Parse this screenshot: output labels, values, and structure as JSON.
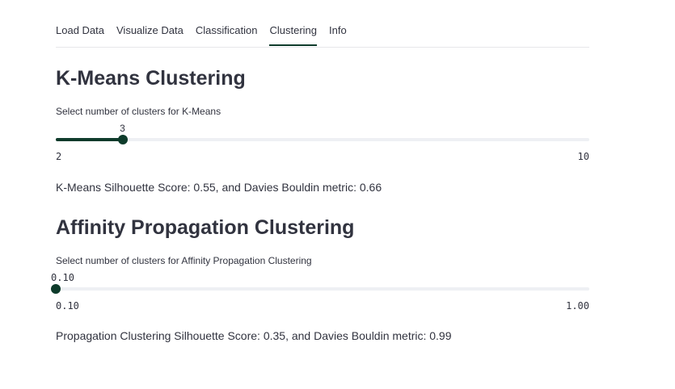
{
  "tabs": [
    {
      "label": "Load Data",
      "active": false
    },
    {
      "label": "Visualize Data",
      "active": false
    },
    {
      "label": "Classification",
      "active": false
    },
    {
      "label": "Clustering",
      "active": true
    },
    {
      "label": "Info",
      "active": false
    }
  ],
  "kmeans": {
    "title": "K-Means Clustering",
    "slider_label": "Select number of clusters for K-Means",
    "slider": {
      "min_label": "2",
      "max_label": "10",
      "value_label": "3",
      "min": 2,
      "max": 10,
      "value": 3
    },
    "result": "K-Means Silhouette Score: 0.55, and Davies Bouldin metric: 0.66"
  },
  "affinity": {
    "title": "Affinity Propagation Clustering",
    "slider_label": "Select number of clusters for Affinity Propagation Clustering",
    "slider": {
      "min_label": "0.10",
      "max_label": "1.00",
      "value_label": "0.10",
      "min": 0.1,
      "max": 1.0,
      "value": 0.1
    },
    "result": "Propagation Clustering Silhouette Score: 0.35, and Davies Bouldin metric: 0.99"
  },
  "colors": {
    "accent": "#0e3b2b",
    "track": "#eef0f4",
    "text": "#31333f"
  }
}
